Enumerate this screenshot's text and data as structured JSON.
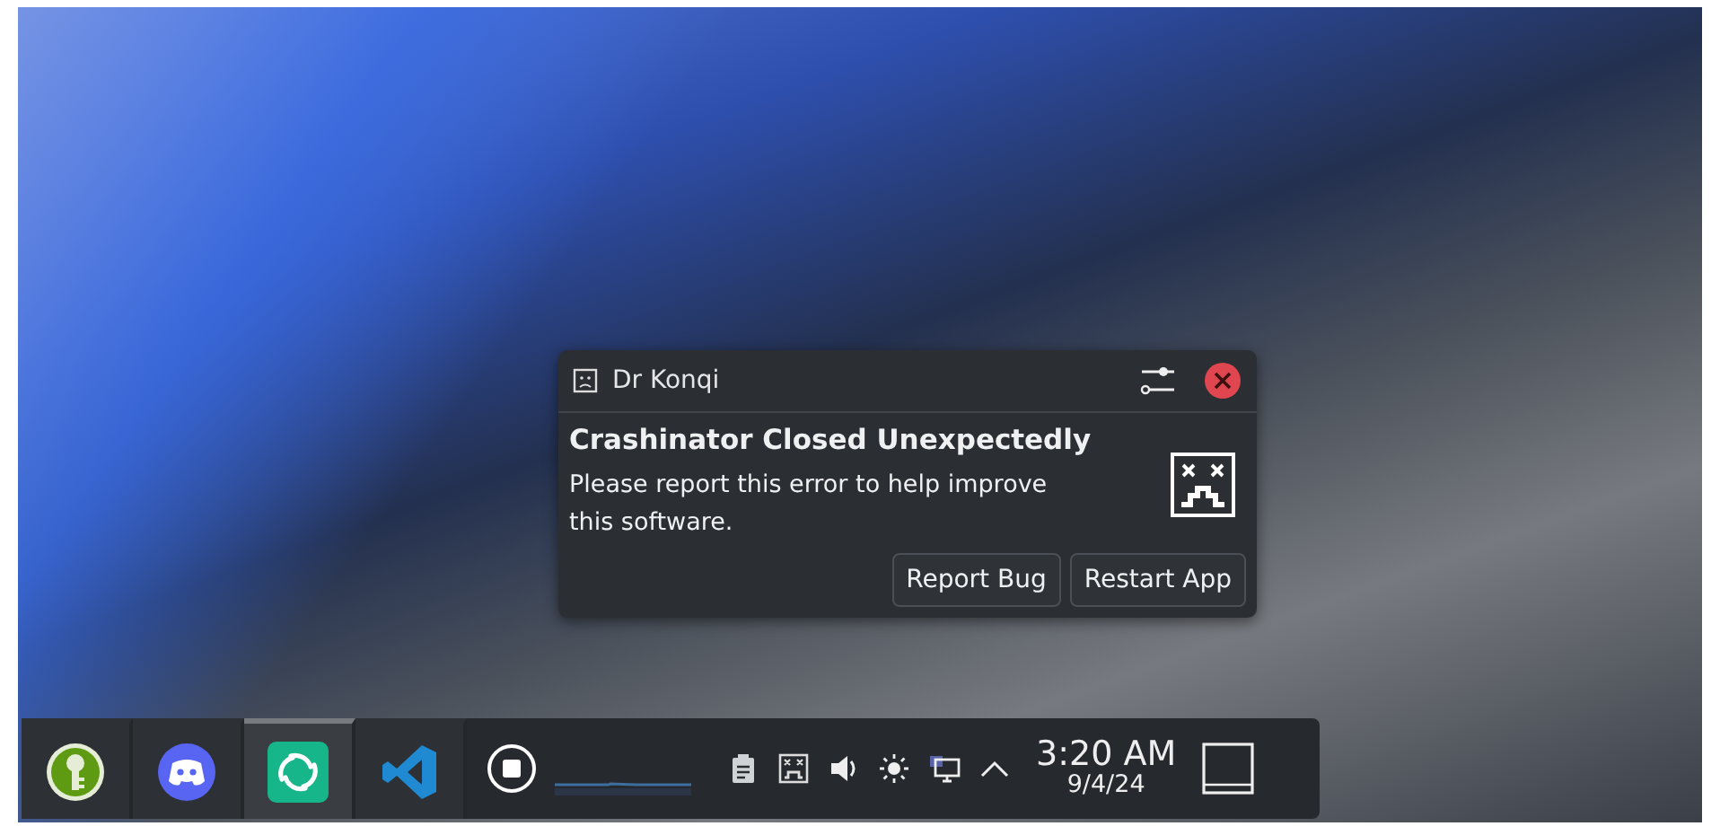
{
  "notification": {
    "app_name": "Dr Konqi",
    "title": "Crashinator Closed Unexpectedly",
    "body": "Please report this error to help improve this software.",
    "actions": [
      "Report Bug",
      "Restart App"
    ]
  },
  "taskbar": {
    "tasks": [
      {
        "kind": "key",
        "selected": false
      },
      {
        "kind": "chat",
        "selected": false
      },
      {
        "kind": "element",
        "selected": true
      },
      {
        "kind": "code",
        "selected": false
      }
    ],
    "clock": {
      "time": "3:20 AM",
      "date": "9/4/24"
    }
  }
}
